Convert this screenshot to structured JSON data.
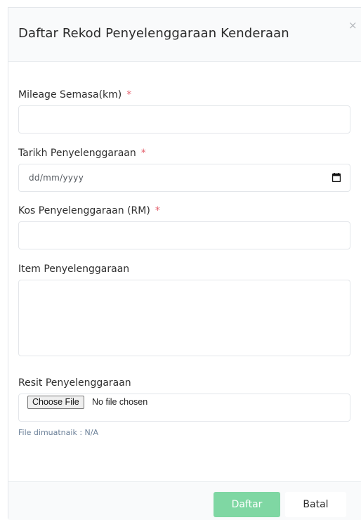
{
  "modal": {
    "title": "Daftar Rekod Penyelenggaraan Kenderaan",
    "close_glyph": "×"
  },
  "fields": {
    "mileage": {
      "label": "Mileage Semasa(km)",
      "required_mark": "*",
      "value": ""
    },
    "date": {
      "label": "Tarikh Penyelenggaraan",
      "required_mark": "*",
      "placeholder": "dd/mm/yyyy",
      "icon": "calendar-icon"
    },
    "cost": {
      "label": "Kos Penyelenggaraan (RM)",
      "required_mark": "*",
      "value": ""
    },
    "items": {
      "label": "Item Penyelenggaraan",
      "value": ""
    },
    "receipt": {
      "label": "Resit Penyelenggaraan",
      "button_label": "Choose File",
      "status_text": "No file chosen",
      "uploaded_note": "File dimuatnaik : N/A"
    }
  },
  "footer": {
    "submit_label": "Daftar",
    "cancel_label": "Batal"
  },
  "colors": {
    "required": "#e4606d",
    "submit_button": "#7fd7a3",
    "header_bg": "#f9fafb",
    "note_text": "#6c8199"
  }
}
